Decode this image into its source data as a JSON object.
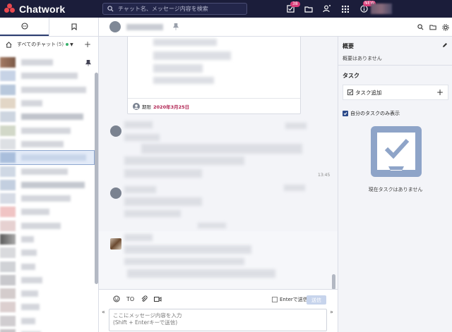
{
  "header": {
    "brand": "Chatwork",
    "search_placeholder": "チャット名、メッセージ内容を検索",
    "task_badge": "38",
    "new_badge": "NEW"
  },
  "sidebar": {
    "filter_label": "すべてのチャット",
    "filter_count": "(5)",
    "room_count": 22
  },
  "timeline": {
    "card_footer_prefix": "期限",
    "card_footer_date": "2020年3月25日",
    "msg_time": "13:45"
  },
  "composer": {
    "to_label": "TO",
    "enter_send_label": "Enterで送信",
    "send_button": "送信",
    "placeholder_line1": "ここにメッセージ内容を入力",
    "placeholder_line2": "(Shift + Enterキーで送信)"
  },
  "right_panel": {
    "overview_title": "概要",
    "overview_empty": "概要はありません",
    "task_title": "タスク",
    "task_add": "タスク追加",
    "only_mine": "自分のタスクのみ表示",
    "no_tasks": "現在タスクはありません"
  },
  "colors": {
    "header_bg": "#1b1d3a",
    "brand_red": "#e8484f",
    "badge_pink": "#d93b78",
    "date_red": "#b02050",
    "panel_bg": "#f3f4f8"
  }
}
